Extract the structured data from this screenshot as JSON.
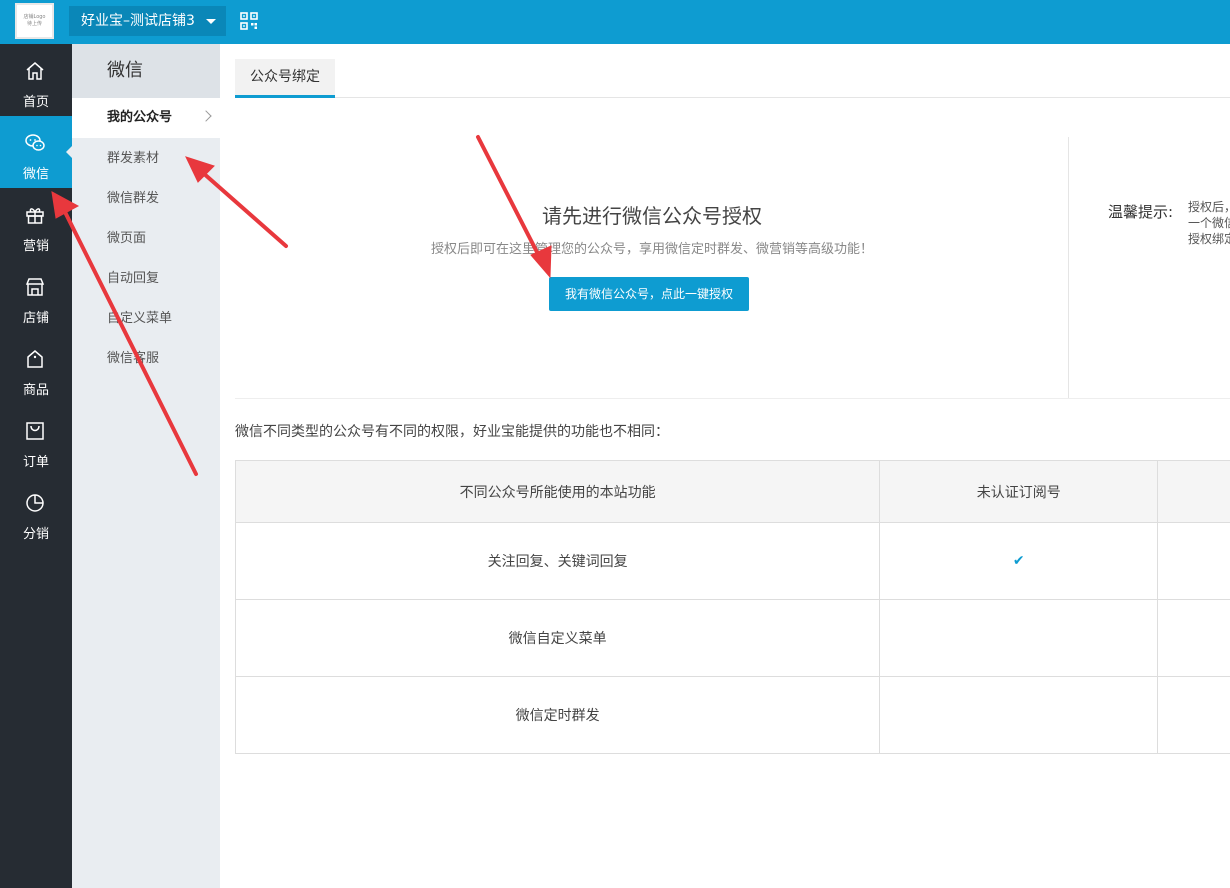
{
  "header": {
    "logo_line1": "店铺Logo",
    "logo_line2": "待上传",
    "store_name": "好业宝–测试店铺3",
    "qr_icon": "qrcode-icon",
    "color": "#0e9cd1"
  },
  "leftnav": {
    "items": [
      {
        "label": "首页",
        "icon": "home-icon"
      },
      {
        "label": "微信",
        "icon": "wechat-icon"
      },
      {
        "label": "营销",
        "icon": "gift-icon"
      },
      {
        "label": "店铺",
        "icon": "store-icon"
      },
      {
        "label": "商品",
        "icon": "bag-icon"
      },
      {
        "label": "订单",
        "icon": "cart-icon"
      },
      {
        "label": "分销",
        "icon": "pie-chart-icon"
      }
    ],
    "active": "微信"
  },
  "subnav": {
    "title": "微信",
    "items": [
      {
        "label": "我的公众号"
      },
      {
        "label": "群发素材"
      },
      {
        "label": "微信群发"
      },
      {
        "label": "微页面"
      },
      {
        "label": "自动回复"
      },
      {
        "label": "自定义菜单"
      },
      {
        "label": "微信客服"
      }
    ],
    "active": "我的公众号"
  },
  "main": {
    "tab": "公众号绑定",
    "auth_title": "请先进行微信公众号授权",
    "auth_subtitle": "授权后即可在这里管理您的公众号，享用微信定时群发、微营销等高级功能！",
    "auth_button": "我有微信公众号，点此一键授权",
    "tip_label": "温馨提示:",
    "tip_lines": [
      "授权后，",
      "一个微信",
      "授权绑定"
    ],
    "intro": "微信不同类型的公众号有不同的权限，好业宝能提供的功能也不相同：",
    "table": {
      "headers": [
        "不同公众号所能使用的本站功能",
        "未认证订阅号",
        ""
      ],
      "rows": [
        {
          "feature": "关注回复、关键词回复",
          "unverified": "✔"
        },
        {
          "feature": "微信自定义菜单",
          "unverified": ""
        },
        {
          "feature": "微信定时群发",
          "unverified": ""
        }
      ]
    }
  }
}
